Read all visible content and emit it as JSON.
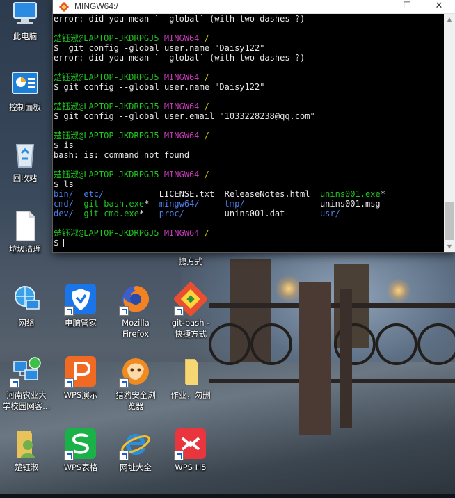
{
  "terminal": {
    "title": "MINGW64:/",
    "buttons": {
      "minimize": "—",
      "maximize": "☐",
      "close": "✕"
    },
    "lines": [
      [
        {
          "t": "error: did you mean `--global` (with two dashes ?)",
          "c": "white"
        }
      ],
      [
        {
          "t": "",
          "c": "white"
        }
      ],
      [
        {
          "t": "楚钰淑@LAPTOP-JKDRPGJ5 ",
          "c": "green"
        },
        {
          "t": "MINGW64 ",
          "c": "magenta"
        },
        {
          "t": "/",
          "c": "yellow"
        }
      ],
      [
        {
          "t": "$  git config -global user.name \"Daisy122\"",
          "c": "white"
        }
      ],
      [
        {
          "t": "error: did you mean `--global` (with two dashes ?)",
          "c": "white"
        }
      ],
      [
        {
          "t": "",
          "c": "white"
        }
      ],
      [
        {
          "t": "楚钰淑@LAPTOP-JKDRPGJ5 ",
          "c": "green"
        },
        {
          "t": "MINGW64 ",
          "c": "magenta"
        },
        {
          "t": "/",
          "c": "yellow"
        }
      ],
      [
        {
          "t": "$ git config --global user.name \"Daisy122\"",
          "c": "white"
        }
      ],
      [
        {
          "t": "",
          "c": "white"
        }
      ],
      [
        {
          "t": "楚钰淑@LAPTOP-JKDRPGJ5 ",
          "c": "green"
        },
        {
          "t": "MINGW64 ",
          "c": "magenta"
        },
        {
          "t": "/",
          "c": "yellow"
        }
      ],
      [
        {
          "t": "$ git config --global user.email \"1033228238@qq.com\"",
          "c": "white"
        }
      ],
      [
        {
          "t": "",
          "c": "white"
        }
      ],
      [
        {
          "t": "楚钰淑@LAPTOP-JKDRPGJ5 ",
          "c": "green"
        },
        {
          "t": "MINGW64 ",
          "c": "magenta"
        },
        {
          "t": "/",
          "c": "yellow"
        }
      ],
      [
        {
          "t": "$ is",
          "c": "white"
        }
      ],
      [
        {
          "t": "bash: is: command not found",
          "c": "white"
        }
      ],
      [
        {
          "t": "",
          "c": "white"
        }
      ],
      [
        {
          "t": "楚钰淑@LAPTOP-JKDRPGJ5 ",
          "c": "green"
        },
        {
          "t": "MINGW64 ",
          "c": "magenta"
        },
        {
          "t": "/",
          "c": "yellow"
        }
      ],
      [
        {
          "t": "$ ls",
          "c": "white"
        }
      ],
      [
        {
          "t": "bin/",
          "c": "blue"
        },
        {
          "t": "  ",
          "c": "white"
        },
        {
          "t": "etc/",
          "c": "blue"
        },
        {
          "t": "           LICENSE.txt  ReleaseNotes.html  ",
          "c": "white"
        },
        {
          "t": "unins001.exe",
          "c": "green"
        },
        {
          "t": "*",
          "c": "white"
        }
      ],
      [
        {
          "t": "cmd/",
          "c": "blue"
        },
        {
          "t": "  ",
          "c": "white"
        },
        {
          "t": "git-bash.exe",
          "c": "green"
        },
        {
          "t": "*  ",
          "c": "white"
        },
        {
          "t": "mingw64/",
          "c": "blue"
        },
        {
          "t": "     ",
          "c": "white"
        },
        {
          "t": "tmp/",
          "c": "blue"
        },
        {
          "t": "               unins001.msg",
          "c": "white"
        }
      ],
      [
        {
          "t": "dev/",
          "c": "blue"
        },
        {
          "t": "  ",
          "c": "white"
        },
        {
          "t": "git-cmd.exe",
          "c": "green"
        },
        {
          "t": "*   ",
          "c": "white"
        },
        {
          "t": "proc/",
          "c": "blue"
        },
        {
          "t": "        unins001.dat       ",
          "c": "white"
        },
        {
          "t": "usr/",
          "c": "blue"
        }
      ],
      [
        {
          "t": "",
          "c": "white"
        }
      ],
      [
        {
          "t": "楚钰淑@LAPTOP-JKDRPGJ5 ",
          "c": "green"
        },
        {
          "t": "MINGW64 ",
          "c": "magenta"
        },
        {
          "t": "/",
          "c": "yellow"
        }
      ],
      [
        {
          "t": "$ ",
          "c": "white"
        },
        {
          "t": "CURSOR",
          "c": "cursor"
        }
      ]
    ]
  },
  "desktop": {
    "icons": [
      {
        "id": "this-pc",
        "label": "此电脑",
        "icon": "computer-icon"
      },
      {
        "id": "control-panel",
        "label": "控制面板",
        "icon": "control-panel-icon"
      },
      {
        "id": "recycle-bin",
        "label": "回收站",
        "icon": "recycle-bin-icon"
      },
      {
        "id": "trash-cleanup",
        "label": "垃圾清理",
        "icon": "file-icon"
      },
      {
        "id": "network",
        "label": "网络",
        "icon": "network-icon"
      },
      {
        "id": "pc-manager",
        "label": "电脑管家",
        "icon": "pc-manager-icon"
      },
      {
        "id": "firefox",
        "label": "Mozilla\nFirefox",
        "icon": "firefox-icon"
      },
      {
        "id": "git-bash",
        "label": "git-bash -\n快捷方式",
        "icon": "git-icon"
      },
      {
        "id": "campus-net",
        "label": "河南农业大\n学校园网客...",
        "icon": "network-client-icon"
      },
      {
        "id": "wps-presentation",
        "label": "WPS演示",
        "icon": "wps-presentation-icon"
      },
      {
        "id": "liebao-browser",
        "label": "猎豹安全浏\n览器",
        "icon": "liebao-browser-icon"
      },
      {
        "id": "homework-folder",
        "label": "作业，勿删",
        "icon": "folder-icon"
      },
      {
        "id": "user-folder",
        "label": "楚钰淑",
        "icon": "user-folder-icon"
      },
      {
        "id": "wps-spreadsheet",
        "label": "WPS表格",
        "icon": "wps-spreadsheet-icon"
      },
      {
        "id": "web-directory",
        "label": "网址大全",
        "icon": "ie-icon"
      },
      {
        "id": "wps-h5",
        "label": "WPS H5",
        "icon": "wps-h5-icon"
      }
    ],
    "partial_label": "捷方式"
  }
}
